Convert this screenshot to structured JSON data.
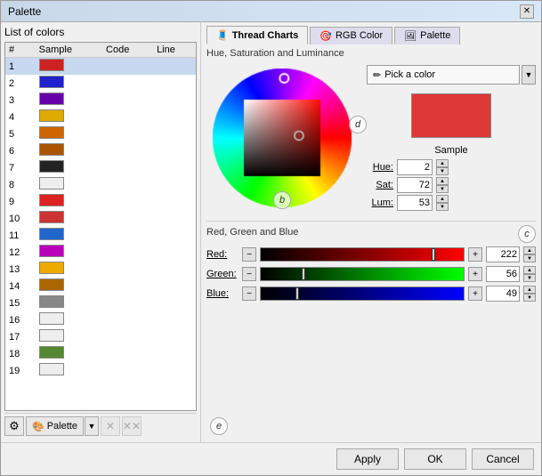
{
  "dialog": {
    "title": "Palette",
    "close_label": "✕"
  },
  "left_panel": {
    "title": "List of colors",
    "columns": [
      "#",
      "Sample",
      "Code",
      "Line"
    ],
    "colors": [
      {
        "num": 1,
        "color": "#cc2222",
        "selected": true
      },
      {
        "num": 2,
        "color": "#2222cc"
      },
      {
        "num": 3,
        "color": "#6600aa"
      },
      {
        "num": 4,
        "color": "#ddaa00"
      },
      {
        "num": 5,
        "color": "#cc6600"
      },
      {
        "num": 6,
        "color": "#aa5500"
      },
      {
        "num": 7,
        "color": "#222222"
      },
      {
        "num": 8,
        "color": "#eeeeee"
      },
      {
        "num": 9,
        "color": "#dd2222"
      },
      {
        "num": 10,
        "color": "#cc3333"
      },
      {
        "num": 11,
        "color": "#2266cc"
      },
      {
        "num": 12,
        "color": "#bb00bb"
      },
      {
        "num": 13,
        "color": "#eeaa00"
      },
      {
        "num": 14,
        "color": "#aa6600"
      },
      {
        "num": 15,
        "color": "#888888"
      },
      {
        "num": 16,
        "color": "#eeeeee"
      },
      {
        "num": 17,
        "color": "#eeeeee"
      },
      {
        "num": 18,
        "color": "#558833"
      },
      {
        "num": 19,
        "color": "#eeeeee"
      }
    ],
    "toolbar": {
      "gear_icon": "⚙",
      "palette_icon": "🎨",
      "palette_label": "Palette",
      "dropdown_arrow": "▼",
      "delete_icon": "✕",
      "delete_disabled_icon": "✕"
    }
  },
  "tabs": [
    {
      "id": "thread-charts",
      "label": "Thread Charts",
      "icon": "🧵",
      "active": true
    },
    {
      "id": "rgb-color",
      "label": "RGB Color",
      "icon": "🎯"
    },
    {
      "id": "palette",
      "label": "Palette",
      "icon": "🖼"
    }
  ],
  "hsl_section": {
    "title": "Hue, Saturation and Luminance",
    "pick_color_label": "Pick a color",
    "pick_dropdown": "▼",
    "sample_label": "Sample",
    "eyedropper_icon": "✏",
    "circle_label_b": "b",
    "circle_label_d": "d",
    "hue": {
      "label": "Hue:",
      "value": "2"
    },
    "sat": {
      "label": "Sat:",
      "value": "72"
    },
    "lum": {
      "label": "Lum:",
      "value": "53"
    }
  },
  "rgb_section": {
    "title": "Red, Green and Blue",
    "circle_label_c": "c",
    "red": {
      "label": "Red:",
      "value": "222",
      "pct": 0.87
    },
    "green": {
      "label": "Green:",
      "value": "56",
      "pct": 0.22
    },
    "blue": {
      "label": "Blue:",
      "value": "49",
      "pct": 0.19
    }
  },
  "circle_e": "e",
  "footer": {
    "apply_label": "Apply",
    "ok_label": "OK",
    "cancel_label": "Cancel"
  }
}
